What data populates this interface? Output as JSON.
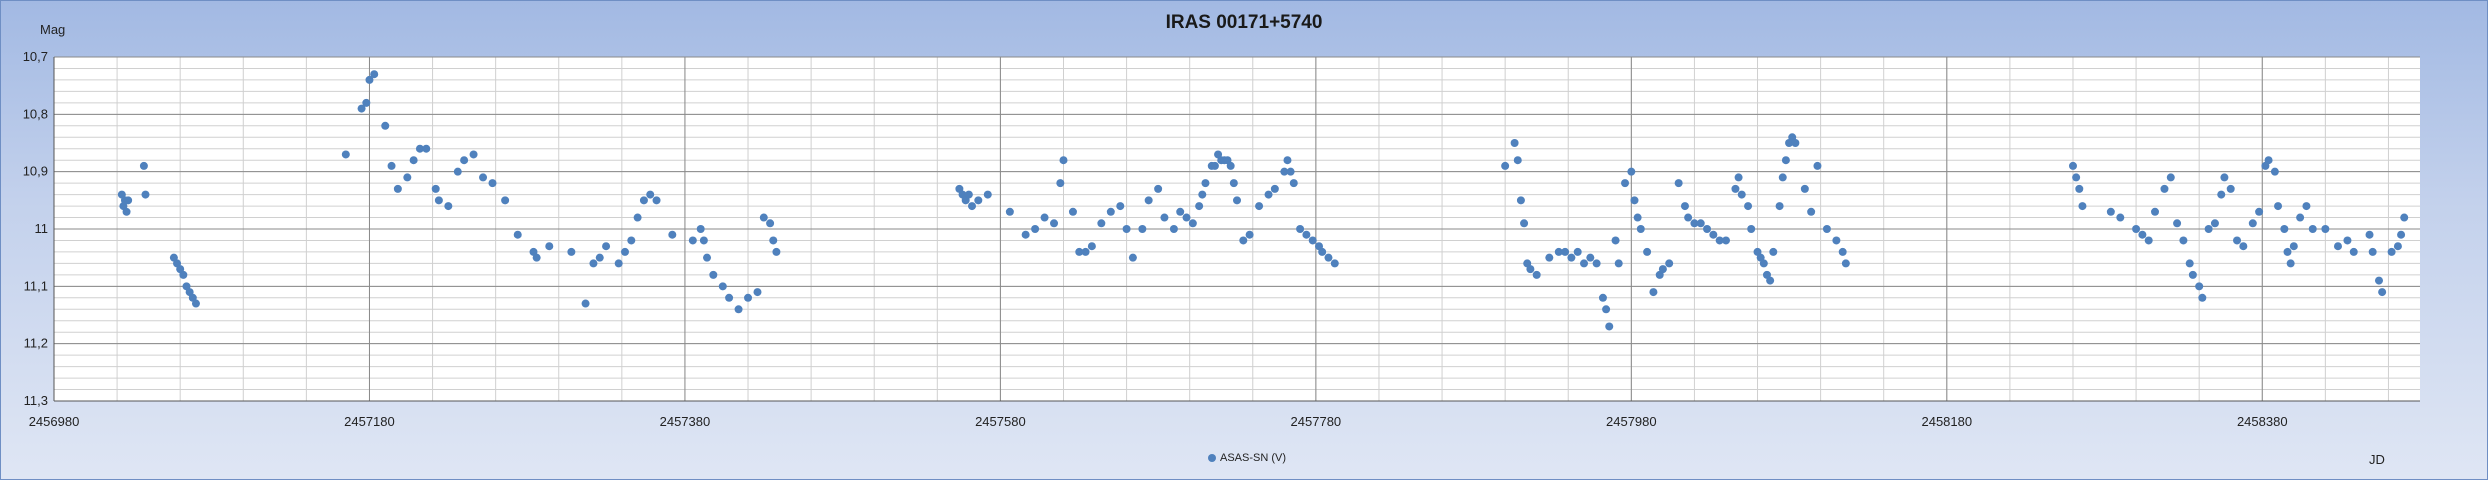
{
  "chart_data": {
    "type": "scatter",
    "title": "IRAS 00171+5740",
    "ylabel": "Mag",
    "xlabel": "JD",
    "xlim": [
      2456980,
      2458480
    ],
    "ylim": [
      10.7,
      11.3
    ],
    "y_inverted": true,
    "x_ticks": [
      "2456980",
      "2457180",
      "2457380",
      "2457580",
      "2457780",
      "2457980",
      "2458180",
      "2458380"
    ],
    "y_ticks": [
      "10,7",
      "10,8",
      "10,9",
      "11",
      "11,1",
      "11,2",
      "11,3"
    ],
    "legend_position": "bottom",
    "grid": true,
    "series": [
      {
        "name": "ASAS-SN (V)",
        "color": "#4f81bd",
        "points": [
          [
            2457023,
            10.94
          ],
          [
            2457024,
            10.96
          ],
          [
            2457025,
            10.95
          ],
          [
            2457026,
            10.97
          ],
          [
            2457027,
            10.95
          ],
          [
            2457037,
            10.89
          ],
          [
            2457038,
            10.94
          ],
          [
            2457056,
            11.05
          ],
          [
            2457058,
            11.06
          ],
          [
            2457060,
            11.07
          ],
          [
            2457062,
            11.08
          ],
          [
            2457064,
            11.1
          ],
          [
            2457066,
            11.11
          ],
          [
            2457068,
            11.12
          ],
          [
            2457070,
            11.13
          ],
          [
            2457165,
            10.87
          ],
          [
            2457175,
            10.79
          ],
          [
            2457178,
            10.78
          ],
          [
            2457180,
            10.74
          ],
          [
            2457183,
            10.73
          ],
          [
            2457190,
            10.82
          ],
          [
            2457194,
            10.89
          ],
          [
            2457198,
            10.93
          ],
          [
            2457204,
            10.91
          ],
          [
            2457208,
            10.88
          ],
          [
            2457212,
            10.86
          ],
          [
            2457216,
            10.86
          ],
          [
            2457222,
            10.93
          ],
          [
            2457224,
            10.95
          ],
          [
            2457230,
            10.96
          ],
          [
            2457236,
            10.9
          ],
          [
            2457240,
            10.88
          ],
          [
            2457246,
            10.87
          ],
          [
            2457252,
            10.91
          ],
          [
            2457258,
            10.92
          ],
          [
            2457266,
            10.95
          ],
          [
            2457274,
            11.01
          ],
          [
            2457284,
            11.04
          ],
          [
            2457286,
            11.05
          ],
          [
            2457294,
            11.03
          ],
          [
            2457308,
            11.04
          ],
          [
            2457317,
            11.13
          ],
          [
            2457322,
            11.06
          ],
          [
            2457326,
            11.05
          ],
          [
            2457330,
            11.03
          ],
          [
            2457338,
            11.06
          ],
          [
            2457342,
            11.04
          ],
          [
            2457346,
            11.02
          ],
          [
            2457350,
            10.98
          ],
          [
            2457354,
            10.95
          ],
          [
            2457358,
            10.94
          ],
          [
            2457362,
            10.95
          ],
          [
            2457372,
            11.01
          ],
          [
            2457385,
            11.02
          ],
          [
            2457390,
            11.0
          ],
          [
            2457392,
            11.02
          ],
          [
            2457394,
            11.05
          ],
          [
            2457398,
            11.08
          ],
          [
            2457404,
            11.1
          ],
          [
            2457408,
            11.12
          ],
          [
            2457414,
            11.14
          ],
          [
            2457420,
            11.12
          ],
          [
            2457426,
            11.11
          ],
          [
            2457430,
            10.98
          ],
          [
            2457434,
            10.99
          ],
          [
            2457436,
            11.02
          ],
          [
            2457438,
            11.04
          ],
          [
            2457554,
            10.93
          ],
          [
            2457556,
            10.94
          ],
          [
            2457558,
            10.95
          ],
          [
            2457560,
            10.94
          ],
          [
            2457562,
            10.96
          ],
          [
            2457566,
            10.95
          ],
          [
            2457572,
            10.94
          ],
          [
            2457586,
            10.97
          ],
          [
            2457596,
            11.01
          ],
          [
            2457602,
            11.0
          ],
          [
            2457608,
            10.98
          ],
          [
            2457614,
            10.99
          ],
          [
            2457618,
            10.92
          ],
          [
            2457620,
            10.88
          ],
          [
            2457626,
            10.97
          ],
          [
            2457630,
            11.04
          ],
          [
            2457634,
            11.04
          ],
          [
            2457638,
            11.03
          ],
          [
            2457644,
            10.99
          ],
          [
            2457650,
            10.97
          ],
          [
            2457656,
            10.96
          ],
          [
            2457660,
            11.0
          ],
          [
            2457664,
            11.05
          ],
          [
            2457670,
            11.0
          ],
          [
            2457674,
            10.95
          ],
          [
            2457680,
            10.93
          ],
          [
            2457684,
            10.98
          ],
          [
            2457690,
            11.0
          ],
          [
            2457694,
            10.97
          ],
          [
            2457698,
            10.98
          ],
          [
            2457702,
            10.99
          ],
          [
            2457706,
            10.96
          ],
          [
            2457708,
            10.94
          ],
          [
            2457710,
            10.92
          ],
          [
            2457714,
            10.89
          ],
          [
            2457716,
            10.89
          ],
          [
            2457718,
            10.87
          ],
          [
            2457720,
            10.88
          ],
          [
            2457722,
            10.88
          ],
          [
            2457724,
            10.88
          ],
          [
            2457726,
            10.89
          ],
          [
            2457728,
            10.92
          ],
          [
            2457730,
            10.95
          ],
          [
            2457734,
            11.02
          ],
          [
            2457738,
            11.01
          ],
          [
            2457744,
            10.96
          ],
          [
            2457750,
            10.94
          ],
          [
            2457754,
            10.93
          ],
          [
            2457760,
            10.9
          ],
          [
            2457762,
            10.88
          ],
          [
            2457764,
            10.9
          ],
          [
            2457766,
            10.92
          ],
          [
            2457770,
            11.0
          ],
          [
            2457774,
            11.01
          ],
          [
            2457778,
            11.02
          ],
          [
            2457782,
            11.03
          ],
          [
            2457784,
            11.04
          ],
          [
            2457788,
            11.05
          ],
          [
            2457792,
            11.06
          ],
          [
            2457900,
            10.89
          ],
          [
            2457906,
            10.85
          ],
          [
            2457908,
            10.88
          ],
          [
            2457910,
            10.95
          ],
          [
            2457912,
            10.99
          ],
          [
            2457914,
            11.06
          ],
          [
            2457916,
            11.07
          ],
          [
            2457920,
            11.08
          ],
          [
            2457928,
            11.05
          ],
          [
            2457934,
            11.04
          ],
          [
            2457938,
            11.04
          ],
          [
            2457942,
            11.05
          ],
          [
            2457946,
            11.04
          ],
          [
            2457950,
            11.06
          ],
          [
            2457954,
            11.05
          ],
          [
            2457958,
            11.06
          ],
          [
            2457962,
            11.12
          ],
          [
            2457964,
            11.14
          ],
          [
            2457966,
            11.17
          ],
          [
            2457970,
            11.02
          ],
          [
            2457972,
            11.06
          ],
          [
            2457976,
            10.92
          ],
          [
            2457980,
            10.9
          ],
          [
            2457982,
            10.95
          ],
          [
            2457984,
            10.98
          ],
          [
            2457986,
            11.0
          ],
          [
            2457990,
            11.04
          ],
          [
            2457994,
            11.11
          ],
          [
            2457998,
            11.08
          ],
          [
            2458000,
            11.07
          ],
          [
            2458004,
            11.06
          ],
          [
            2458010,
            10.92
          ],
          [
            2458014,
            10.96
          ],
          [
            2458016,
            10.98
          ],
          [
            2458020,
            10.99
          ],
          [
            2458024,
            10.99
          ],
          [
            2458028,
            11.0
          ],
          [
            2458032,
            11.01
          ],
          [
            2458036,
            11.02
          ],
          [
            2458040,
            11.02
          ],
          [
            2458046,
            10.93
          ],
          [
            2458048,
            10.91
          ],
          [
            2458050,
            10.94
          ],
          [
            2458054,
            10.96
          ],
          [
            2458056,
            11.0
          ],
          [
            2458060,
            11.04
          ],
          [
            2458062,
            11.05
          ],
          [
            2458064,
            11.06
          ],
          [
            2458066,
            11.08
          ],
          [
            2458068,
            11.09
          ],
          [
            2458070,
            11.04
          ],
          [
            2458074,
            10.96
          ],
          [
            2458076,
            10.91
          ],
          [
            2458078,
            10.88
          ],
          [
            2458080,
            10.85
          ],
          [
            2458082,
            10.84
          ],
          [
            2458084,
            10.85
          ],
          [
            2458090,
            10.93
          ],
          [
            2458094,
            10.97
          ],
          [
            2458098,
            10.89
          ],
          [
            2458104,
            11.0
          ],
          [
            2458110,
            11.02
          ],
          [
            2458114,
            11.04
          ],
          [
            2458116,
            11.06
          ],
          [
            2458260,
            10.89
          ],
          [
            2458262,
            10.91
          ],
          [
            2458264,
            10.93
          ],
          [
            2458266,
            10.96
          ],
          [
            2458284,
            10.97
          ],
          [
            2458290,
            10.98
          ],
          [
            2458300,
            11.0
          ],
          [
            2458304,
            11.01
          ],
          [
            2458308,
            11.02
          ],
          [
            2458312,
            10.97
          ],
          [
            2458318,
            10.93
          ],
          [
            2458322,
            10.91
          ],
          [
            2458326,
            10.99
          ],
          [
            2458330,
            11.02
          ],
          [
            2458334,
            11.06
          ],
          [
            2458336,
            11.08
          ],
          [
            2458340,
            11.1
          ],
          [
            2458342,
            11.12
          ],
          [
            2458346,
            11.0
          ],
          [
            2458350,
            10.99
          ],
          [
            2458354,
            10.94
          ],
          [
            2458356,
            10.91
          ],
          [
            2458360,
            10.93
          ],
          [
            2458364,
            11.02
          ],
          [
            2458368,
            11.03
          ],
          [
            2458374,
            10.99
          ],
          [
            2458378,
            10.97
          ],
          [
            2458382,
            10.89
          ],
          [
            2458384,
            10.88
          ],
          [
            2458388,
            10.9
          ],
          [
            2458390,
            10.96
          ],
          [
            2458394,
            11.0
          ],
          [
            2458396,
            11.04
          ],
          [
            2458398,
            11.06
          ],
          [
            2458400,
            11.03
          ],
          [
            2458404,
            10.98
          ],
          [
            2458408,
            10.96
          ],
          [
            2458412,
            11.0
          ],
          [
            2458420,
            11.0
          ],
          [
            2458428,
            11.03
          ],
          [
            2458434,
            11.02
          ],
          [
            2458438,
            11.04
          ],
          [
            2458448,
            11.01
          ],
          [
            2458450,
            11.04
          ],
          [
            2458454,
            11.09
          ],
          [
            2458456,
            11.11
          ],
          [
            2458462,
            11.04
          ],
          [
            2458466,
            11.03
          ],
          [
            2458468,
            11.01
          ],
          [
            2458470,
            10.98
          ]
        ]
      }
    ]
  }
}
